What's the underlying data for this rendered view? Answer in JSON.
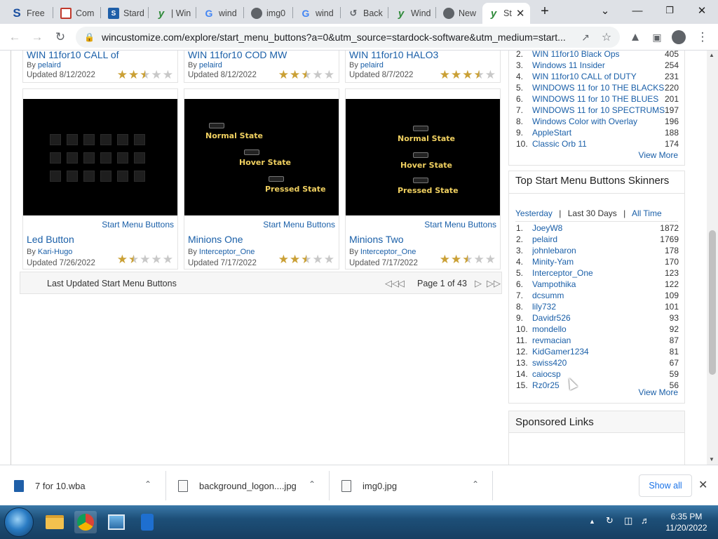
{
  "browser": {
    "tabs": [
      {
        "label": "Free",
        "icon": "stardock-s-icon",
        "color": "#1a4fa0"
      },
      {
        "label": "Com",
        "icon": "calendar-icon",
        "color": "#c0392b"
      },
      {
        "label": "Stard",
        "icon": "stardock-icon",
        "color": "#1f5fa8"
      },
      {
        "label": "| Win",
        "icon": "wincustomize-icon",
        "color": "#2f8a3a"
      },
      {
        "label": "wind",
        "icon": "google-icon",
        "color": "#ffffff"
      },
      {
        "label": "img0",
        "icon": "globe-icon",
        "color": "#5f6368"
      },
      {
        "label": "wind",
        "icon": "google-icon",
        "color": "#ffffff"
      },
      {
        "label": "Back",
        "icon": "backup-icon",
        "color": "#5f6368"
      },
      {
        "label": "Wind",
        "icon": "wincustomize-icon",
        "color": "#2f8a3a"
      },
      {
        "label": "New",
        "icon": "chrome-icon",
        "color": "#5f6368"
      },
      {
        "label": "St",
        "icon": "wincustomize-icon",
        "color": "#2f8a3a",
        "active": true
      }
    ],
    "new_tab_symbol": "+",
    "url": "wincustomize.com/explore/start_menu_buttons?a=0&utm_source=stardock-software&utm_medium=start..."
  },
  "top_cards": [
    {
      "title": "WIN 11for10 CALL of",
      "by_prefix": "By",
      "author": "pelaird",
      "updated": "Updated 8/12/2022",
      "rating": 2.5
    },
    {
      "title": "WIN 11for10 COD MW",
      "by_prefix": "By",
      "author": "pelaird",
      "updated": "Updated 8/12/2022",
      "rating": 2.5
    },
    {
      "title": "WIN 11for10 HALO3",
      "by_prefix": "By",
      "author": "pelaird",
      "updated": "Updated 8/7/2022",
      "rating": 3.5
    }
  ],
  "cards": [
    {
      "title": "Led Button",
      "category": "Start Menu Buttons",
      "by_prefix": "By",
      "author": "Kari-Hugo",
      "updated": "Updated 7/26/2022",
      "rating": 1.5,
      "thumb": "led"
    },
    {
      "title": "Minions One",
      "category": "Start Menu Buttons",
      "by_prefix": "By",
      "author": "Interceptor_One",
      "updated": "Updated 7/17/2022",
      "rating": 2.5,
      "thumb": "minion1",
      "thumb_labels": [
        "Normal State",
        "Hover State",
        "Pressed State"
      ]
    },
    {
      "title": "Minions Two",
      "category": "Start Menu Buttons",
      "by_prefix": "By",
      "author": "Interceptor_One",
      "updated": "Updated 7/17/2022",
      "rating": 2.5,
      "thumb": "minion2",
      "thumb_labels": [
        "Normal State",
        "Hover State",
        "Pressed State"
      ]
    }
  ],
  "pager": {
    "label": "Last Updated Start Menu Buttons",
    "info": "Page 1 of 43"
  },
  "top_downloads": {
    "rows": [
      {
        "rank": "2.",
        "name": "WIN 11for10 Black Ops",
        "count": "405"
      },
      {
        "rank": "3.",
        "name": "Windows 11 Insider",
        "count": "254"
      },
      {
        "rank": "4.",
        "name": "WIN 11for10 CALL of DUTY",
        "count": "231"
      },
      {
        "rank": "5.",
        "name": "WINDOWS 11 for 10 THE BLACKS",
        "count": "220"
      },
      {
        "rank": "6.",
        "name": "WINDOWS 11 for 10 THE BLUES",
        "count": "201"
      },
      {
        "rank": "7.",
        "name": "WINDOWS 11 for 10 SPECTRUMS",
        "count": "197"
      },
      {
        "rank": "8.",
        "name": "Windows Color with Overlay",
        "count": "196"
      },
      {
        "rank": "9.",
        "name": "AppleStart",
        "count": "188"
      },
      {
        "rank": "10.",
        "name": "Classic Orb 11",
        "count": "174"
      }
    ],
    "view_more": "View More"
  },
  "skinners": {
    "title": "Top Start Menu Buttons Skinners",
    "period_yesterday": "Yesterday",
    "period_30": "Last 30 Days",
    "period_all": "All Time",
    "sep": "|",
    "rows": [
      {
        "rank": "1.",
        "name": "JoeyW8",
        "count": "1872"
      },
      {
        "rank": "2.",
        "name": "pelaird",
        "count": "1769"
      },
      {
        "rank": "3.",
        "name": "johnlebaron",
        "count": "178"
      },
      {
        "rank": "4.",
        "name": "Minity-Yam",
        "count": "170"
      },
      {
        "rank": "5.",
        "name": "Interceptor_One",
        "count": "123"
      },
      {
        "rank": "6.",
        "name": "Vampothika",
        "count": "122"
      },
      {
        "rank": "7.",
        "name": "dcsumm",
        "count": "109"
      },
      {
        "rank": "8.",
        "name": "lily732",
        "count": "101"
      },
      {
        "rank": "9.",
        "name": "Davidr526",
        "count": "93"
      },
      {
        "rank": "10.",
        "name": "mondello",
        "count": "92"
      },
      {
        "rank": "11.",
        "name": "revmacian",
        "count": "87"
      },
      {
        "rank": "12.",
        "name": "KidGamer1234",
        "count": "81"
      },
      {
        "rank": "13.",
        "name": "swiss420",
        "count": "67"
      },
      {
        "rank": "14.",
        "name": "caiocsp",
        "count": "59"
      },
      {
        "rank": "15.",
        "name": "Rz0r25",
        "count": "56"
      }
    ],
    "view_more": "View More"
  },
  "sponsored": {
    "title": "Sponsored Links"
  },
  "downloads": {
    "items": [
      "7 for 10.wba",
      "background_logon....jpg",
      "img0.jpg"
    ],
    "show_all": "Show all"
  },
  "taskbar": {
    "time": "6:35 PM",
    "date": "11/20/2022"
  },
  "colors": {
    "link": "#1a5fa8",
    "star": "#caa035",
    "accent": "#1a73e8"
  }
}
